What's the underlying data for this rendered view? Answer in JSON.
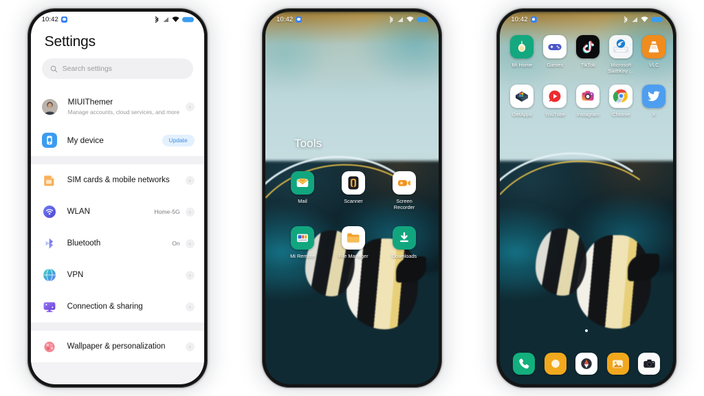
{
  "statusbar": {
    "time": "10:42",
    "icons": [
      "bluetooth-icon",
      "signal-icon",
      "wifi-icon",
      "battery-icon"
    ],
    "badge": "notification-dot-icon"
  },
  "phone1_settings": {
    "title": "Settings",
    "search": {
      "placeholder": "Search settings",
      "icon": "search-icon"
    },
    "groups": [
      {
        "rows": [
          {
            "icon": "user-avatar",
            "label": "MIUIThemer",
            "sublabel": "Manage accounts, cloud services, and more",
            "value": "",
            "chevron": "›",
            "pill": ""
          },
          {
            "icon": "device-icon",
            "label": "My device",
            "sublabel": "",
            "value": "",
            "chevron": "",
            "pill": "Update"
          }
        ]
      },
      {
        "rows": [
          {
            "icon": "sim-card-icon",
            "label": "SIM cards & mobile networks",
            "sublabel": "",
            "value": "",
            "chevron": "›",
            "pill": ""
          },
          {
            "icon": "wlan-icon",
            "label": "WLAN",
            "sublabel": "",
            "value": "Home-5G",
            "chevron": "›",
            "pill": ""
          },
          {
            "icon": "bluetooth-icon",
            "label": "Bluetooth",
            "sublabel": "",
            "value": "On",
            "chevron": "›",
            "pill": ""
          },
          {
            "icon": "vpn-icon",
            "label": "VPN",
            "sublabel": "",
            "value": "",
            "chevron": "›",
            "pill": ""
          },
          {
            "icon": "connection-sharing-icon",
            "label": "Connection & sharing",
            "sublabel": "",
            "value": "",
            "chevron": "›",
            "pill": ""
          }
        ]
      },
      {
        "rows": [
          {
            "icon": "wallpaper-icon",
            "label": "Wallpaper & personalization",
            "sublabel": "",
            "value": "",
            "chevron": "›",
            "pill": ""
          }
        ]
      }
    ]
  },
  "phone2_folder": {
    "title": "Tools",
    "apps": [
      {
        "name": "Mail",
        "icon": "mail-icon"
      },
      {
        "name": "Scanner",
        "icon": "scanner-icon"
      },
      {
        "name": "Screen Recorder",
        "icon": "screen-recorder-icon"
      },
      {
        "name": "Mi Remote",
        "icon": "mi-remote-icon"
      },
      {
        "name": "File Manager",
        "icon": "file-manager-icon"
      },
      {
        "name": "Downloads",
        "icon": "downloads-icon"
      }
    ]
  },
  "phone3_home": {
    "apps": [
      {
        "name": "Mi Home",
        "icon": "mi-home-icon"
      },
      {
        "name": "Games",
        "icon": "games-icon"
      },
      {
        "name": "TikTok",
        "icon": "tiktok-icon"
      },
      {
        "name": "Microsoft SwiftKey …",
        "icon": "swiftkey-icon"
      },
      {
        "name": "VLC",
        "icon": "vlc-icon"
      },
      {
        "name": "GetApps",
        "icon": "getapps-icon"
      },
      {
        "name": "YouTube",
        "icon": "youtube-icon"
      },
      {
        "name": "Instagram",
        "icon": "instagram-icon"
      },
      {
        "name": "Chrome",
        "icon": "chrome-icon"
      },
      {
        "name": "X",
        "icon": "twitter-bird-icon"
      }
    ],
    "dock": [
      {
        "name": "Phone",
        "icon": "phone-icon"
      },
      {
        "name": "Themes",
        "icon": "themes-icon"
      },
      {
        "name": "Browser",
        "icon": "browser-compass-icon"
      },
      {
        "name": "Gallery",
        "icon": "gallery-icon"
      },
      {
        "name": "Camera",
        "icon": "camera-icon"
      }
    ],
    "page_dots": 1
  },
  "colors": {
    "accent_blue": "#3b82f6",
    "pill_bg": "#e3f0fd",
    "pill_text": "#3f8fe0",
    "settings_bg": "#f1f1f4",
    "card_bg": "#ffffff"
  }
}
